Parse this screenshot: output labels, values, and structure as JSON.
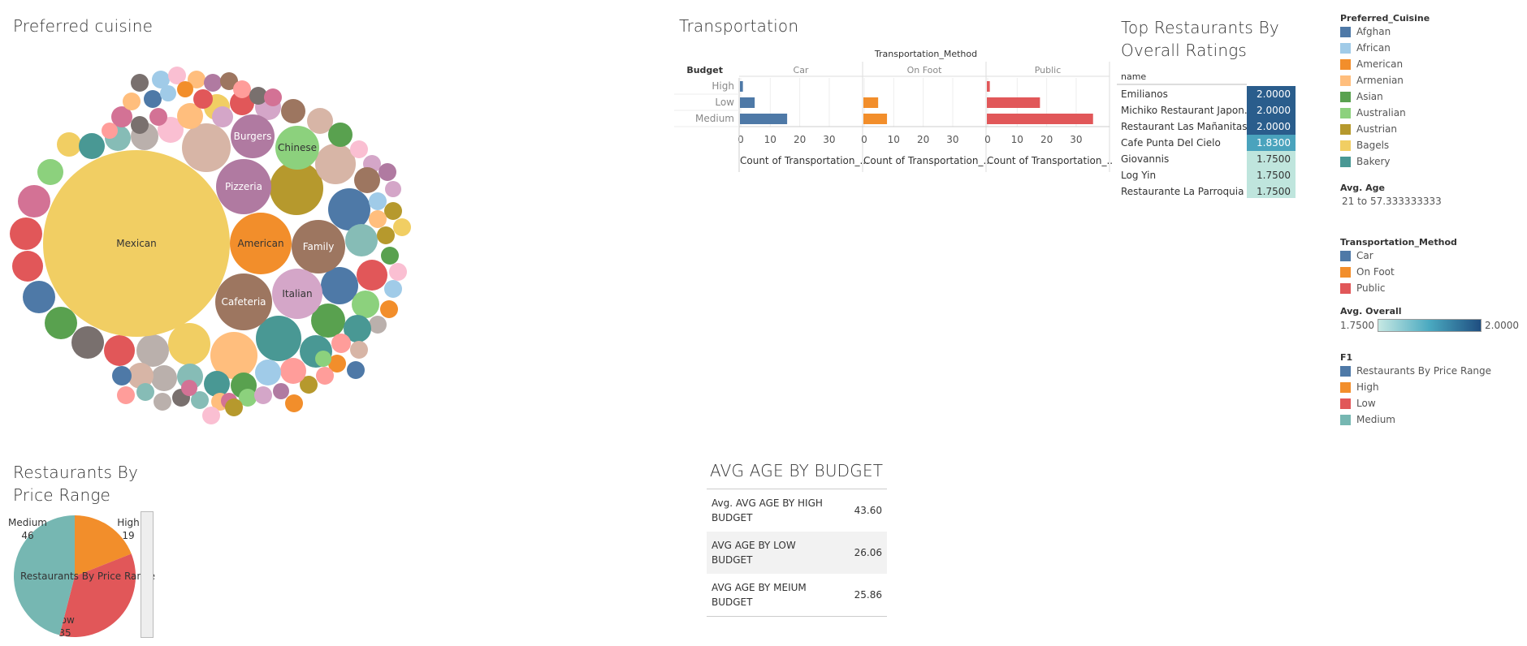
{
  "titles": {
    "cuisine": "Preferred cuisine",
    "transport": "Transportation",
    "top": "Top Restaurants By Overall Ratings",
    "price": "Restaurants By Price Range",
    "avgage": "AVG AGE BY BUDGET"
  },
  "chart_data": [
    {
      "type": "bubble",
      "title": "Preferred cuisine",
      "labels": [
        "Mexican",
        "American",
        "Pizzeria",
        "Burgers",
        "Chinese",
        "Family",
        "Cafeteria",
        "Italian"
      ]
    },
    {
      "type": "bar",
      "title": "Transportation",
      "column_header": "Transportation_Method",
      "row_header": "Budget",
      "panels": [
        "Car",
        "On Foot",
        "Public"
      ],
      "categories": [
        "High",
        "Low",
        "Medium"
      ],
      "series": [
        {
          "name": "Car",
          "values": [
            1,
            5,
            16
          ],
          "color": "#4e79a7"
        },
        {
          "name": "On Foot",
          "values": [
            0,
            5,
            8
          ],
          "color": "#f28e2b"
        },
        {
          "name": "Public",
          "values": [
            1,
            18,
            36
          ],
          "color": "#e15759"
        }
      ],
      "xticks": [
        "0",
        "10",
        "20",
        "30"
      ],
      "xlabel": "Count of Transportation_...",
      "xlim": [
        0,
        38
      ]
    },
    {
      "type": "table",
      "title": "Top Restaurants By Overall Ratings",
      "column": "name",
      "rows": [
        {
          "name": "Emilianos",
          "value": "2.0000"
        },
        {
          "name": "Michiko Restaurant Japon..",
          "value": "2.0000"
        },
        {
          "name": "Restaurant Las Mañanitas",
          "value": "2.0000"
        },
        {
          "name": "Cafe Punta Del Cielo",
          "value": "1.8300"
        },
        {
          "name": "Giovannis",
          "value": "1.7500"
        },
        {
          "name": "Log Yin",
          "value": "1.7500"
        },
        {
          "name": "Restaurante La Parroquia ..",
          "value": "1.7500"
        }
      ]
    },
    {
      "type": "pie",
      "title": "Restaurants By Price Range",
      "center_label": "Restaurants By Price Range",
      "slices": [
        {
          "name": "High",
          "value": 19,
          "color": "#f28e2b"
        },
        {
          "name": "Low",
          "value": 35,
          "color": "#e15759"
        },
        {
          "name": "Medium",
          "value": 46,
          "color": "#76b7b2"
        }
      ]
    },
    {
      "type": "table",
      "title": "AVG AGE BY BUDGET",
      "rows": [
        {
          "label": "Avg. AVG AGE BY HIGH BUDGET",
          "value": "43.60"
        },
        {
          "label": "AVG AGE BY LOW BUDGET",
          "value": "26.06"
        },
        {
          "label": "AVG AGE BY MEIUM BUDGET",
          "value": "25.86"
        }
      ]
    }
  ],
  "legend": {
    "cuisine_title": "Preferred_Cuisine",
    "cuisine_items": [
      {
        "label": "Afghan",
        "color": "#4e79a7"
      },
      {
        "label": "African",
        "color": "#a0cbe8"
      },
      {
        "label": "American",
        "color": "#f28e2b"
      },
      {
        "label": "Armenian",
        "color": "#ffbe7d"
      },
      {
        "label": "Asian",
        "color": "#59a14f"
      },
      {
        "label": "Australian",
        "color": "#8cd17d"
      },
      {
        "label": "Austrian",
        "color": "#b6992d"
      },
      {
        "label": "Bagels",
        "color": "#f1ce63"
      },
      {
        "label": "Bakery",
        "color": "#499894"
      }
    ],
    "age_title": "Avg. Age",
    "age_range": "21 to 57.333333333",
    "transport_title": "Transportation_Method",
    "transport_items": [
      {
        "label": "Car",
        "color": "#4e79a7"
      },
      {
        "label": "On Foot",
        "color": "#f28e2b"
      },
      {
        "label": "Public",
        "color": "#e15759"
      }
    ],
    "overall_title": "Avg. Overall",
    "overall_min": "1.7500",
    "overall_max": "2.0000",
    "f1_title": "F1",
    "f1_items": [
      {
        "label": "Restaurants By Price Range",
        "color": "#4e79a7"
      },
      {
        "label": "High",
        "color": "#f28e2b"
      },
      {
        "label": "Low",
        "color": "#e15759"
      },
      {
        "label": "Medium",
        "color": "#76b7b2"
      }
    ]
  }
}
